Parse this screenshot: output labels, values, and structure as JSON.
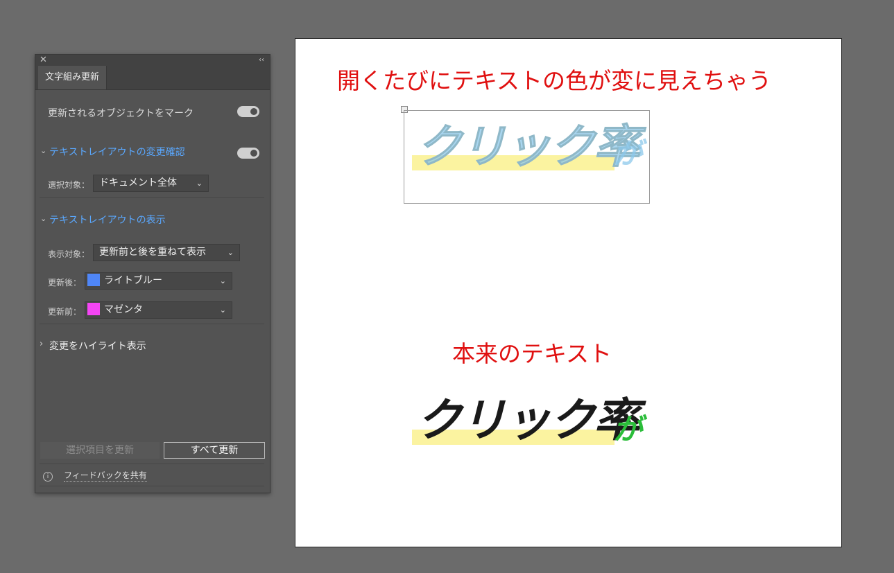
{
  "panel": {
    "tab_label": "文字組み更新",
    "mark_objects_label": "更新されるオブジェクトをマーク",
    "mark_objects_on": true,
    "section_confirm": {
      "title": "テキストレイアウトの変更確認",
      "enabled": true,
      "target_label": "選択対象：",
      "target_value": "ドキュメント全体"
    },
    "section_display": {
      "title": "テキストレイアウトの表示",
      "display_label": "表示対象：",
      "display_value": "更新前と後を重ねて表示",
      "after_label": "更新後：",
      "after_value": "ライトブルー",
      "after_color": "#4f86f7",
      "before_label": "更新前：",
      "before_value": "マゼンタ",
      "before_color": "#f545f5"
    },
    "section_highlight": {
      "title": "変更をハイライト表示"
    },
    "update_selected_label": "選択項目を更新",
    "update_all_label": "すべて更新",
    "feedback_label": "フィードバックを共有",
    "accent_color": "#5aa8ff"
  },
  "canvas": {
    "heading": "開くたびにテキストの色が変に見えちゃう",
    "original_label": "本来のテキスト",
    "sample_main": "クリック率",
    "sample_suffix": "が",
    "sample_main_color": "#1a1a1a",
    "sample_suffix_color": "#2bbd3a",
    "highlight_color": "#fbf3a0",
    "heading_color": "#e01010"
  }
}
